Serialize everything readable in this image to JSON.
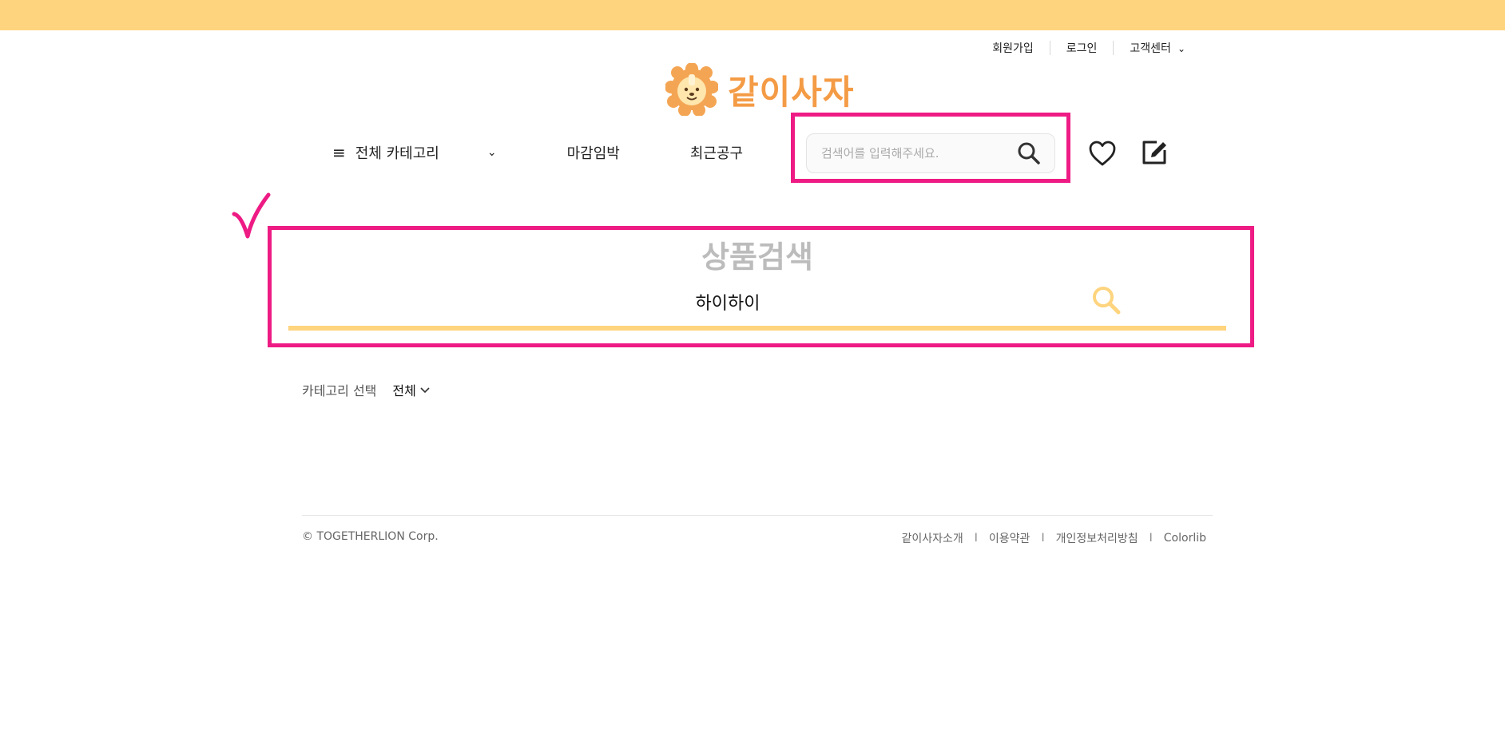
{
  "top_bar_color": "#ffd47e",
  "util_nav": {
    "signup": "회원가입",
    "login": "로그인",
    "support": "고객센터",
    "support_chevron": "⌄"
  },
  "logo": {
    "text": "같이사자",
    "icon": "lion-logo-icon"
  },
  "main_nav": {
    "all_categories": "전체 카테고리",
    "closing_soon": "마감임박",
    "recent_group_buy": "최근공구"
  },
  "header_search": {
    "placeholder": "검색어를 입력해주세요.",
    "value": ""
  },
  "icons": {
    "wishlist": "heart-icon",
    "write": "edit-icon"
  },
  "search_section": {
    "title": "상품검색",
    "value": "하이하이"
  },
  "filter": {
    "label": "카테고리 선택",
    "selected": "전체"
  },
  "footer": {
    "copyright": "© TOGETHERLION Corp.",
    "links": [
      "같이사자소개",
      "이용약관",
      "개인정보처리방침",
      "Colorlib"
    ],
    "separator": "I"
  },
  "colors": {
    "accent": "#ffd47e",
    "brand": "#f49b45",
    "highlight": "#ee1b84"
  }
}
